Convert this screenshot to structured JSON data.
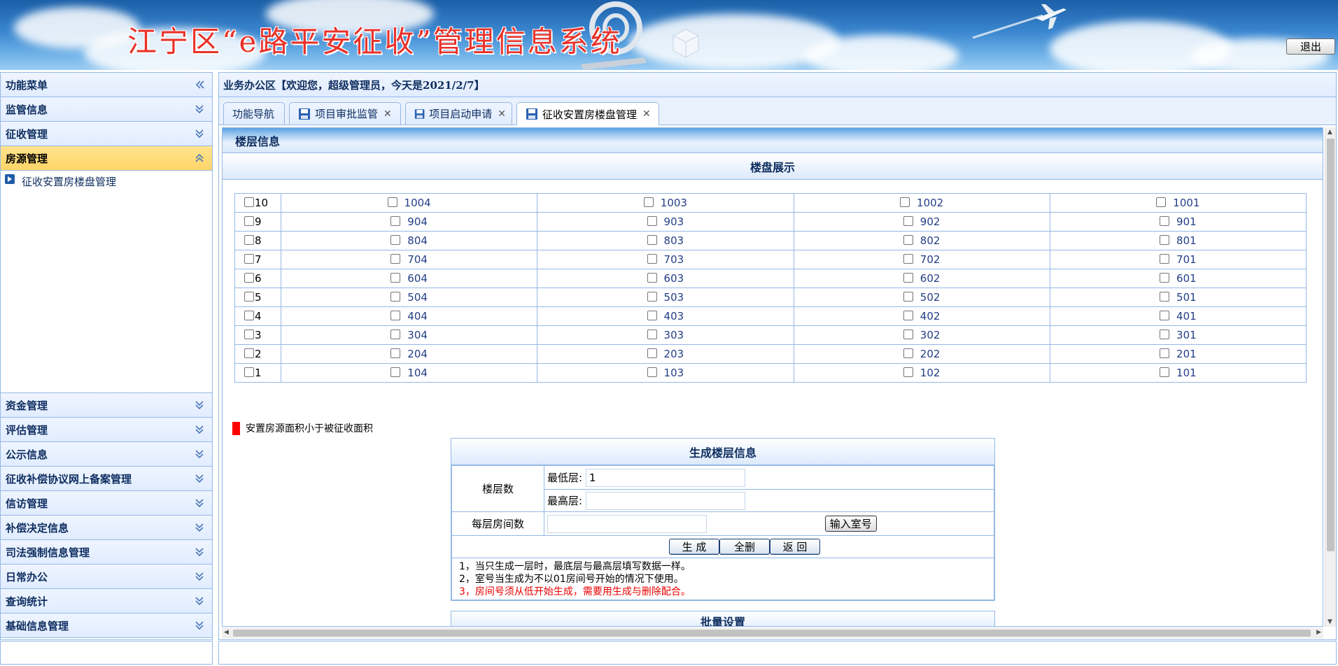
{
  "banner": {
    "title": "江宁区“e路平安征收”管理信息系统",
    "logout_label": "退出"
  },
  "left_menu": {
    "header": "功能菜单",
    "sections_top": [
      "监管信息",
      "征收管理"
    ],
    "active_section": "房源管理",
    "active_items": [
      "征收安置房楼盘管理"
    ],
    "sections_bottom": [
      "资金管理",
      "评估管理",
      "公示信息",
      "征收补偿协议网上备案管理",
      "信访管理",
      "补偿决定信息",
      "司法强制信息管理",
      "日常办公",
      "查询统计",
      "基础信息管理"
    ]
  },
  "workarea": {
    "title": "业务办公区【欢迎您，超级管理员，今天是2021/2/7】"
  },
  "tabs": [
    {
      "label": "功能导航",
      "icon": "",
      "closable": false,
      "active": false
    },
    {
      "label": "项目审批监管",
      "icon": "save-icon",
      "closable": true,
      "active": false
    },
    {
      "label": "项目启动申请",
      "icon": "save-icon",
      "closable": true,
      "active": false
    },
    {
      "label": "征收安置房楼盘管理",
      "icon": "save-icon",
      "closable": true,
      "active": true
    }
  ],
  "floor_panel": {
    "title": "楼层信息",
    "subtitle": "楼盘展示",
    "rows": [
      {
        "floor": "10",
        "rooms": [
          "1004",
          "1003",
          "1002",
          "1001"
        ]
      },
      {
        "floor": "9",
        "rooms": [
          "904",
          "903",
          "902",
          "901"
        ]
      },
      {
        "floor": "8",
        "rooms": [
          "804",
          "803",
          "802",
          "801"
        ]
      },
      {
        "floor": "7",
        "rooms": [
          "704",
          "703",
          "702",
          "701"
        ]
      },
      {
        "floor": "6",
        "rooms": [
          "604",
          "603",
          "602",
          "601"
        ]
      },
      {
        "floor": "5",
        "rooms": [
          "504",
          "503",
          "502",
          "501"
        ]
      },
      {
        "floor": "4",
        "rooms": [
          "404",
          "403",
          "402",
          "401"
        ]
      },
      {
        "floor": "3",
        "rooms": [
          "304",
          "303",
          "302",
          "301"
        ]
      },
      {
        "floor": "2",
        "rooms": [
          "204",
          "203",
          "202",
          "201"
        ]
      },
      {
        "floor": "1",
        "rooms": [
          "104",
          "103",
          "102",
          "101"
        ]
      }
    ],
    "legend": {
      "text": "安置房源面积小于被征收面积",
      "color": "#ff0000"
    }
  },
  "generate": {
    "title": "生成楼层信息",
    "floors_label": "楼层数",
    "min_label": "最低层:",
    "min_value": "1",
    "max_label": "最高层:",
    "max_value": "",
    "rooms_label": "每层房间数",
    "rooms_value": "",
    "input_room_btn": "输入室号",
    "gen_btn": "生 成",
    "delete_btn": "全删",
    "back_btn": "返 回",
    "notes": [
      "1，当只生成一层时，最底层与最高层填写数据一样。",
      "2，室号当生成为不以01房间号开始的情况下使用。",
      "3，房间号须从低开始生成，需要用生成与删除配合。"
    ],
    "batch_title": "批量设置"
  }
}
